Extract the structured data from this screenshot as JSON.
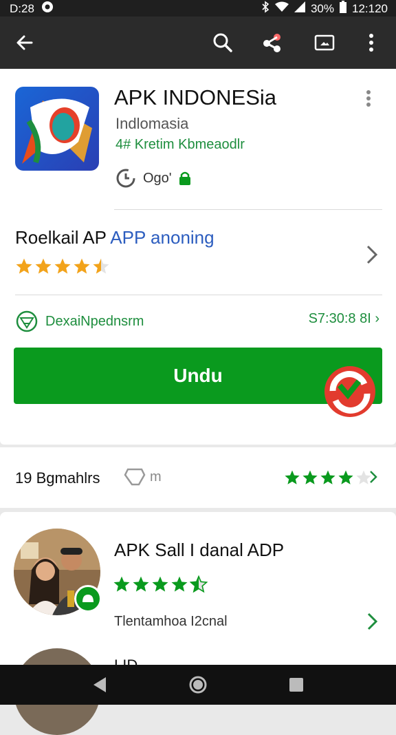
{
  "status_bar": {
    "time_left": "D:28",
    "battery": "30%",
    "clock": "12:120"
  },
  "app": {
    "title": "APK INDONESia",
    "developer": "Indlomasia",
    "category": "4# Kretim Kbmeaodlr",
    "content_rating": "Ogo'"
  },
  "rating_section": {
    "title_black": "Roelkail AP ",
    "title_blue": "APP anoning",
    "stars": 4.5
  },
  "developer_row": {
    "label": "DexaiNpednsrm",
    "right": "S7:30:8 8I"
  },
  "install": {
    "label": "Undu"
  },
  "stats_row": {
    "count": "19 Bgmahlrs",
    "middle": "m",
    "stars": 4
  },
  "review": {
    "title": "APK Sall I danal ADP",
    "stars": 4.5,
    "meta": "Tlentamhoa I2cnal",
    "next_peek": "LID"
  },
  "colors": {
    "accent_green": "#0a9a1e",
    "star_orange": "#f2a31b",
    "link_blue": "#2c5dbf",
    "app_bar": "#2b2b2b"
  }
}
